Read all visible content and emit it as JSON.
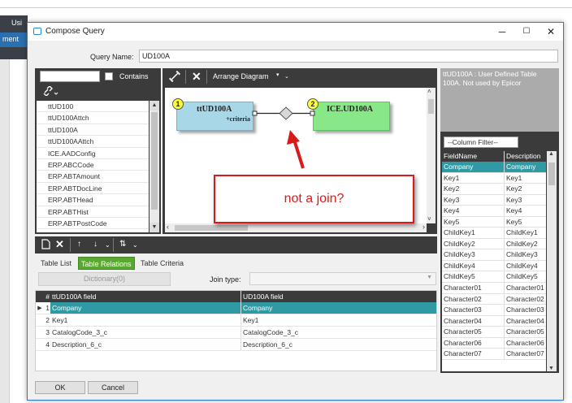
{
  "background": {
    "title_fragment": "Usi",
    "side_fragment": "ment"
  },
  "window": {
    "title": "Compose Query",
    "minimize": "─",
    "maximize": "☐",
    "close": "✕"
  },
  "query": {
    "label": "Query Name:",
    "value": "UD100A"
  },
  "table_panel": {
    "search_value": "",
    "contains_label": "Contains",
    "contains_checked": false,
    "tables": [
      "ttUD100",
      "ttUD100Attch",
      "ttUD100A",
      "ttUD100AAttch",
      "ICE.AADConfig",
      "ERP.ABCCode",
      "ERP.ABTAmount",
      "ERP.ABTDocLine",
      "ERP.ABTHead",
      "ERP.ABTHist",
      "ERP.ABTPostCode"
    ]
  },
  "diagram": {
    "toolbar": {
      "arrange_label": "Arrange Diagram"
    },
    "left_table": {
      "badge": "1",
      "name": "ttUD100A",
      "criteria": "+criteria"
    },
    "right_table": {
      "badge": "2",
      "name": "ICE.UD100A"
    }
  },
  "description": {
    "text": "ttUD100A : User Defined Table 100A.  Not used by Epicor"
  },
  "column_panel": {
    "filter_text": "--Column Filter--",
    "headers": [
      "FieldName",
      "Description"
    ],
    "rows": [
      [
        "Company",
        "Company"
      ],
      [
        "Key1",
        "Key1"
      ],
      [
        "Key2",
        "Key2"
      ],
      [
        "Key3",
        "Key3"
      ],
      [
        "Key4",
        "Key4"
      ],
      [
        "Key5",
        "Key5"
      ],
      [
        "ChildKey1",
        "ChildKey1"
      ],
      [
        "ChildKey2",
        "ChildKey2"
      ],
      [
        "ChildKey3",
        "ChildKey3"
      ],
      [
        "ChildKey4",
        "ChildKey4"
      ],
      [
        "ChildKey5",
        "ChildKey5"
      ],
      [
        "Character01",
        "Character01"
      ],
      [
        "Character02",
        "Character02"
      ],
      [
        "Character03",
        "Character03"
      ],
      [
        "Character04",
        "Character04"
      ],
      [
        "Character05",
        "Character05"
      ],
      [
        "Character06",
        "Character06"
      ],
      [
        "Character07",
        "Character07"
      ]
    ]
  },
  "bottom": {
    "tabs": [
      "Table List",
      "Table Relations",
      "Table Criteria"
    ],
    "active_tab": "Table Relations",
    "dictionary_label": "Dictionary(0)",
    "join_type_label": "Join type:",
    "join_type_value": "",
    "grid_headers": [
      "#",
      "ttUD100A field",
      "UD100A field"
    ],
    "relations": [
      [
        "1",
        "Company",
        "Company"
      ],
      [
        "2",
        "Key1",
        "Key1"
      ],
      [
        "3",
        "CatalogCode_3_c",
        "CatalogCode_3_c"
      ],
      [
        "4",
        "Description_6_c",
        "Description_6_c"
      ]
    ]
  },
  "buttons": {
    "ok": "OK",
    "cancel": "Cancel"
  },
  "annotation": {
    "text": "not a join?",
    "color": "#d91a1a"
  },
  "colors": {
    "accent": "#2f9aa3",
    "active_tab": "#5aa832",
    "left_table": "#a8d8e8",
    "right_table": "#88e888"
  }
}
